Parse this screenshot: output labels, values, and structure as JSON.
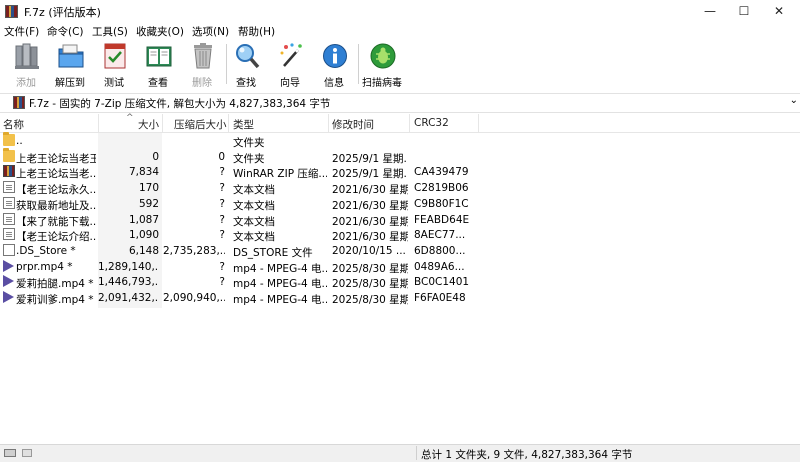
{
  "window": {
    "title": "F.7z (评估版本)",
    "minimize": "—",
    "maximize": "☐",
    "close": "✕"
  },
  "menu": [
    "文件(F)",
    "命令(C)",
    "工具(S)",
    "收藏夹(O)",
    "选项(N)",
    "帮助(H)"
  ],
  "toolbar": [
    {
      "label": "添加",
      "icon": "add-books-icon",
      "disabled": true
    },
    {
      "label": "解压到",
      "icon": "extract-folder-icon",
      "disabled": false
    },
    {
      "label": "测试",
      "icon": "test-checklist-icon",
      "disabled": false
    },
    {
      "label": "查看",
      "icon": "view-book-icon",
      "disabled": false
    },
    {
      "label": "删除",
      "icon": "trash-icon",
      "disabled": true
    },
    {
      "label": "查找",
      "icon": "magnifier-icon",
      "disabled": false
    },
    {
      "label": "向导",
      "icon": "wizard-wand-icon",
      "disabled": false
    },
    {
      "label": "信息",
      "icon": "info-icon",
      "disabled": false
    },
    {
      "label": "扫描病毒",
      "icon": "bug-scan-icon",
      "disabled": false
    }
  ],
  "address": {
    "text": "F.7z - 固实的 7-Zip 压缩文件, 解包大小为 4,827,383,364 字节",
    "chevron": "⌄"
  },
  "columns": {
    "name": "名称",
    "size": "大小",
    "packed": "压缩后大小",
    "type": "类型",
    "modified": "修改时间",
    "crc": "CRC32",
    "sort_arrow": "^"
  },
  "rows": [
    {
      "icon": "folder",
      "name": "..",
      "size": "",
      "packed": "",
      "type": "文件夹",
      "modified": "",
      "crc": ""
    },
    {
      "icon": "folder",
      "name": "上老王论坛当老王",
      "size": "0",
      "packed": "0",
      "type": "文件夹",
      "modified": "2025/9/1 星期...",
      "crc": ""
    },
    {
      "icon": "rar",
      "name": "上老王论坛当老...",
      "size": "7,834",
      "packed": "?",
      "type": "WinRAR ZIP 压缩...",
      "modified": "2025/9/1 星期...",
      "crc": "CA439479"
    },
    {
      "icon": "txt",
      "name": "【老王论坛永久...",
      "size": "170",
      "packed": "?",
      "type": "文本文档",
      "modified": "2021/6/30 星期...",
      "crc": "C2819B06"
    },
    {
      "icon": "txt",
      "name": "获取最新地址及...",
      "size": "592",
      "packed": "?",
      "type": "文本文档",
      "modified": "2021/6/30 星期...",
      "crc": "C9B80F1C"
    },
    {
      "icon": "txt",
      "name": "【来了就能下载...",
      "size": "1,087",
      "packed": "?",
      "type": "文本文档",
      "modified": "2021/6/30 星期...",
      "crc": "FEABD64E"
    },
    {
      "icon": "txt",
      "name": "【老王论坛介绍...",
      "size": "1,090",
      "packed": "?",
      "type": "文本文档",
      "modified": "2021/6/30 星期...",
      "crc": "8AEC77..."
    },
    {
      "icon": "file",
      "name": ".DS_Store *",
      "size": "6,148",
      "packed": "2,735,283,...",
      "type": "DS_STORE 文件",
      "modified": "2020/10/15 ...",
      "crc": "6D8800..."
    },
    {
      "icon": "mp4",
      "name": "prpr.mp4 *",
      "size": "1,289,140,...",
      "packed": "?",
      "type": "mp4 - MPEG-4 电...",
      "modified": "2025/8/30 星期...",
      "crc": "0489A6..."
    },
    {
      "icon": "mp4",
      "name": "爱莉拍腿.mp4 *",
      "size": "1,446,793,...",
      "packed": "?",
      "type": "mp4 - MPEG-4 电...",
      "modified": "2025/8/30 星期...",
      "crc": "BC0C1401"
    },
    {
      "icon": "mp4",
      "name": "爱莉训爹.mp4 *",
      "size": "2,091,432,...",
      "packed": "2,090,940,...",
      "type": "mp4 - MPEG-4 电...",
      "modified": "2025/8/30 星期...",
      "crc": "F6FA0E48"
    }
  ],
  "status": {
    "summary": "总计 1 文件夹, 9 文件, 4,827,383,364 字节"
  }
}
